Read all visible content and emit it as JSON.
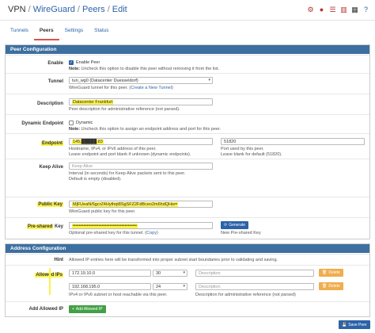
{
  "breadcrumb": {
    "vpn": "VPN",
    "wireguard": "WireGuard",
    "peers": "Peers",
    "edit": "Edit",
    "sep": "/"
  },
  "top_icons": [
    "sliders-icon",
    "stop-icon",
    "list-icon",
    "chart-icon",
    "table-icon",
    "help-icon"
  ],
  "tabs": [
    {
      "label": "Tunnels",
      "active": false
    },
    {
      "label": "Peers",
      "active": true
    },
    {
      "label": "Settings",
      "active": false
    },
    {
      "label": "Status",
      "active": false
    }
  ],
  "peer_config": {
    "title": "Peer Configuration",
    "enable": {
      "label": "Enable",
      "checkbox_label": "Enable Peer",
      "checked": true,
      "note_prefix": "Note:",
      "note": " Uncheck this option to disable this peer without removing it from the list."
    },
    "tunnel": {
      "label": "Tunnel",
      "value": "tun_wg0 (Datacenter Duesseldorf)",
      "help": "WireGuard tunnel for this peer. (",
      "help_link": "Create a New Tunnel",
      "help_end": ")"
    },
    "description": {
      "label": "Description",
      "value": "Datacenter Frankfurt",
      "help": "Peer description for administrative reference (not parsed)."
    },
    "dynamic_endpoint": {
      "label": "Dynamic Endpoint",
      "checkbox_label": "Dynamic",
      "checked": false,
      "note_prefix": "Note:",
      "note": " Uncheck this option to assign an endpoint address and port for this peer."
    },
    "endpoint": {
      "label": "Endpoint",
      "value": "145.█████.83",
      "help1": "Hostname, IPv4, or IPv6 address of this peer.",
      "help2": "Leave endpoint and port blank if unknown (dynamic endpoints).",
      "port_value": "51820",
      "port_help1": "Port used by this peer.",
      "port_help2": "Leave blank for default (51820)."
    },
    "keep_alive": {
      "label": "Keep Alive",
      "placeholder": "Keep Alive",
      "help1": "Interval (in seconds) for Keep Alive packets sent to this peer.",
      "help2": "Default is empty (disabled)."
    },
    "public_key": {
      "label": "Public Key",
      "value": "MjFUeaN/6gcrZ4Hythqt8SgSFZ2FdBceo2m6hdQHw=",
      "help": "WireGuard public key for this peer."
    },
    "psk": {
      "label_main": "Pre-shared",
      "label_rest": " Key",
      "value": "••••••••••••••••••••••••••••••••••••••••••",
      "help": "Optional pre-shared key for this tunnel. (",
      "help_link": "Copy",
      "help_end": ")",
      "generate_label": "Generate",
      "generate_help": "New Pre-shared Key"
    }
  },
  "address_config": {
    "title": "Address Configuration",
    "hint": {
      "label": "Hint",
      "text": "Allowed IP entries here will be transformed into proper subnet start boundaries prior to validating and saving."
    },
    "allowed_ips": {
      "label": "Allowed IPs",
      "rows": [
        {
          "ip": "172.19.10.0",
          "mask": "30",
          "desc_placeholder": "Description",
          "delete_label": "Delete"
        },
        {
          "ip": "192.168.195.0",
          "mask": "24",
          "desc_placeholder": "Description",
          "delete_label": "Delete"
        }
      ],
      "help_ip": "IPv4 or IPv6 subnet or host reachable via this peer.",
      "help_desc": "Description for administrative reference (not parsed)"
    },
    "add_allowed_ip": {
      "label": "Add Allowed IP",
      "button_label": "Add Allowed IP"
    }
  },
  "save_label": "Save Peer",
  "colors": {
    "accent": "#3d6fa0",
    "link": "#2b63a8",
    "highlight": "#fbf24b",
    "danger": "#d9534f",
    "success": "#43a047",
    "warning": "#f0ad4e"
  }
}
